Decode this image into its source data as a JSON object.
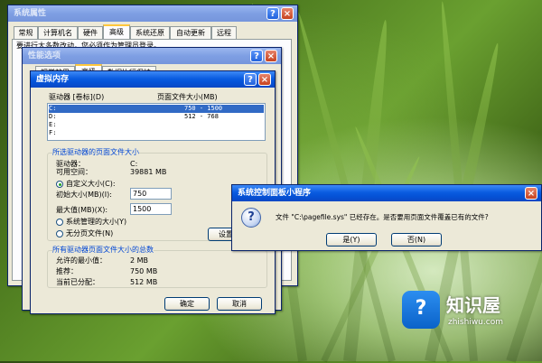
{
  "system_properties": {
    "title": "系统属性",
    "tabs": [
      "常规",
      "计算机名",
      "硬件",
      "高级",
      "系统还原",
      "自动更新",
      "远程"
    ],
    "active_tab": 3,
    "hint": "要进行大多数改动，您必须作为管理员登录。",
    "buttons": {
      "help": "?",
      "close": "×"
    }
  },
  "performance_options": {
    "title": "性能选项",
    "tabs": [
      "视觉效果",
      "高级",
      "数据执行保护"
    ],
    "buttons": {
      "help": "?",
      "close": "×"
    }
  },
  "virtual_memory": {
    "title": "虚拟内存",
    "buttons": {
      "help": "?",
      "close": "×"
    },
    "list_header": {
      "drive": "驱动器 [卷标](D)",
      "pagefile": "页面文件大小(MB)"
    },
    "drives": [
      {
        "drive": "C:",
        "pagefile": "750 - 1500",
        "selected": true
      },
      {
        "drive": "D:",
        "pagefile": "512 - 768",
        "selected": false
      },
      {
        "drive": "E:",
        "pagefile": "",
        "selected": false
      },
      {
        "drive": "F:",
        "pagefile": "",
        "selected": false
      }
    ],
    "selected_group": {
      "title": "所选驱动器的页面文件大小",
      "drive_label": "驱动器：",
      "drive_value": "C:",
      "free_label": "可用空间：",
      "free_value": "39881 MB",
      "custom_size": "自定义大小(C):",
      "initial_label": "初始大小(MB)(I):",
      "initial_value": "750",
      "max_label": "最大值(MB)(X):",
      "max_value": "1500",
      "system_managed": "系统管理的大小(Y)",
      "no_paging": "无分页文件(N)",
      "set_button": "设置",
      "selected_option": "custom"
    },
    "total_group": {
      "title": "所有驱动器页面文件大小的总数",
      "min_label": "允许的最小值：",
      "min_value": "2 MB",
      "recommended_label": "推荐：",
      "recommended_value": "750 MB",
      "current_label": "当前已分配：",
      "current_value": "512 MB"
    },
    "ok_button": "确定",
    "cancel_button": "取消"
  },
  "control_panel_dialog": {
    "title": "系统控制面板小程序",
    "icon": "question-icon",
    "message": "文件 \"C:\\pagefile.sys\" 已经存在。是否要用页面文件覆盖已有的文件?",
    "yes_button": "是(Y)",
    "no_button": "否(N)"
  },
  "watermark": {
    "brand_cn": "知识屋",
    "brand_url": "zhishiwu.com"
  }
}
